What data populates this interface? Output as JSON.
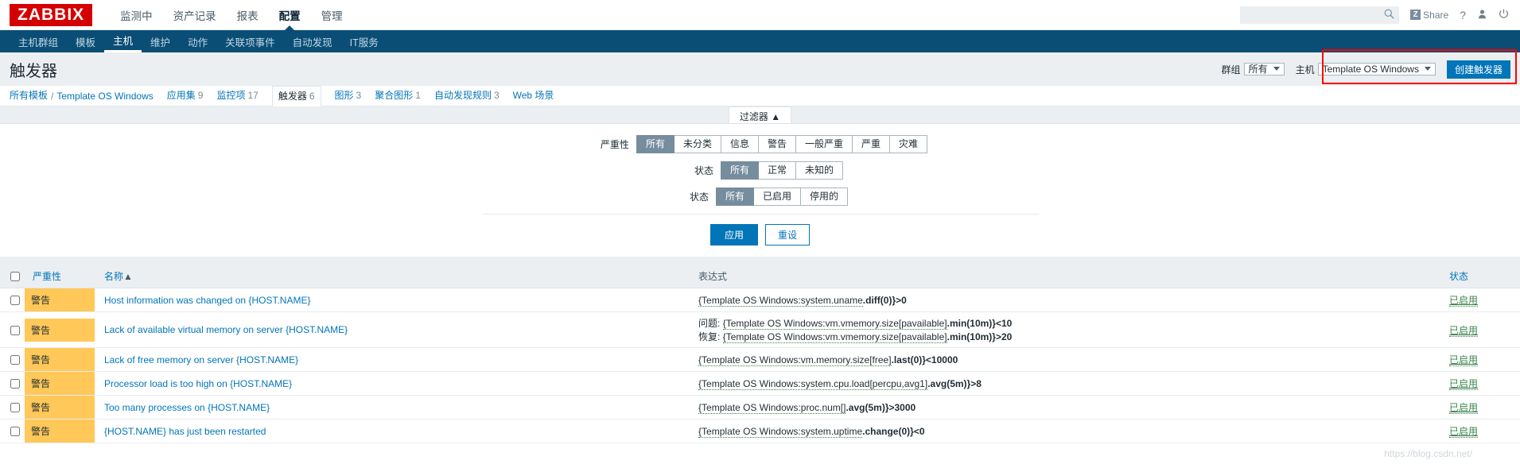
{
  "header": {
    "logo": "ZABBIX",
    "nav": [
      {
        "label": "监测中",
        "active": false
      },
      {
        "label": "资产记录",
        "active": false
      },
      {
        "label": "报表",
        "active": false
      },
      {
        "label": "配置",
        "active": true
      },
      {
        "label": "管理",
        "active": false
      }
    ],
    "search_placeholder": "",
    "search_value": "",
    "search_icon": "search-icon",
    "share_label": "Share",
    "share_badge": "Z",
    "help_label": "?",
    "user_icon": "user-icon",
    "power_icon": "power-icon"
  },
  "subnav": {
    "items": [
      {
        "label": "主机群组",
        "active": false
      },
      {
        "label": "模板",
        "active": false
      },
      {
        "label": "主机",
        "active": true
      },
      {
        "label": "维护",
        "active": false
      },
      {
        "label": "动作",
        "active": false
      },
      {
        "label": "关联项事件",
        "active": false
      },
      {
        "label": "自动发现",
        "active": false
      },
      {
        "label": "IT服务",
        "active": false
      }
    ]
  },
  "page": {
    "title": "触发器",
    "group_label": "群组",
    "group_value": "所有",
    "host_label": "主机",
    "host_value": "Template OS Windows",
    "create_button": "创建触发器",
    "highlight_color": "#ff0000"
  },
  "breadcrumb": {
    "root": "所有模板",
    "separator": "/",
    "template": "Template OS Windows",
    "tabs": [
      {
        "label": "应用集",
        "count": "9",
        "active": false
      },
      {
        "label": "监控项",
        "count": "17",
        "active": false
      },
      {
        "label": "触发器",
        "count": "6",
        "active": true
      },
      {
        "label": "图形",
        "count": "3",
        "active": false
      },
      {
        "label": "聚合图形",
        "count": "1",
        "active": false
      },
      {
        "label": "自动发现规则",
        "count": "3",
        "active": false
      },
      {
        "label": "Web 场景",
        "count": "",
        "active": false
      }
    ]
  },
  "filter": {
    "tab_label": "过滤器",
    "tab_arrow": "▲",
    "rows": [
      {
        "name": "严重性",
        "options": [
          {
            "label": "所有",
            "on": true
          },
          {
            "label": "未分类",
            "on": false
          },
          {
            "label": "信息",
            "on": false
          },
          {
            "label": "警告",
            "on": false
          },
          {
            "label": "一般严重",
            "on": false
          },
          {
            "label": "严重",
            "on": false
          },
          {
            "label": "灾难",
            "on": false
          }
        ]
      },
      {
        "name": "状态",
        "options": [
          {
            "label": "所有",
            "on": true
          },
          {
            "label": "正常",
            "on": false
          },
          {
            "label": "未知的",
            "on": false
          }
        ]
      },
      {
        "name": "状态",
        "options": [
          {
            "label": "所有",
            "on": true
          },
          {
            "label": "已启用",
            "on": false
          },
          {
            "label": "停用的",
            "on": false
          }
        ]
      }
    ],
    "apply_label": "应用",
    "reset_label": "重设"
  },
  "table": {
    "columns": {
      "severity": "严重性",
      "name": "名称",
      "sort_arrow": "▲",
      "expression": "表达式",
      "status": "状态"
    },
    "rows": [
      {
        "severity": "警告",
        "name": "Host information was changed on {HOST.NAME}",
        "expression_lines": [
          {
            "label": "",
            "item": "{Template OS Windows:system.uname",
            "fn": ".diff(0)}",
            "op": ">0"
          }
        ],
        "status": "已启用"
      },
      {
        "severity": "警告",
        "name": "Lack of available virtual memory on server {HOST.NAME}",
        "expression_lines": [
          {
            "label": "问题: ",
            "item": "{Template OS Windows:vm.vmemory.size[pavailable]",
            "fn": ".min(10m)}",
            "op": "<10"
          },
          {
            "label": "恢复: ",
            "item": "{Template OS Windows:vm.vmemory.size[pavailable]",
            "fn": ".min(10m)}",
            "op": ">20"
          }
        ],
        "status": "已启用"
      },
      {
        "severity": "警告",
        "name": "Lack of free memory on server {HOST.NAME}",
        "expression_lines": [
          {
            "label": "",
            "item": "{Template OS Windows:vm.memory.size[free]",
            "fn": ".last(0)}",
            "op": "<10000"
          }
        ],
        "status": "已启用"
      },
      {
        "severity": "警告",
        "name": "Processor load is too high on {HOST.NAME}",
        "expression_lines": [
          {
            "label": "",
            "item": "{Template OS Windows:system.cpu.load[percpu,avg1]",
            "fn": ".avg(5m)}",
            "op": ">8"
          }
        ],
        "status": "已启用"
      },
      {
        "severity": "警告",
        "name": "Too many processes on {HOST.NAME}",
        "expression_lines": [
          {
            "label": "",
            "item": "{Template OS Windows:proc.num[]",
            "fn": ".avg(5m)}",
            "op": ">3000"
          }
        ],
        "status": "已启用"
      },
      {
        "severity": "警告",
        "name": "{HOST.NAME} has just been restarted",
        "expression_lines": [
          {
            "label": "",
            "item": "{Template OS Windows:system.uptime",
            "fn": ".change(0)}",
            "op": "<0"
          }
        ],
        "status": "已启用"
      }
    ]
  },
  "watermark": "https://blog.csdn.net/"
}
